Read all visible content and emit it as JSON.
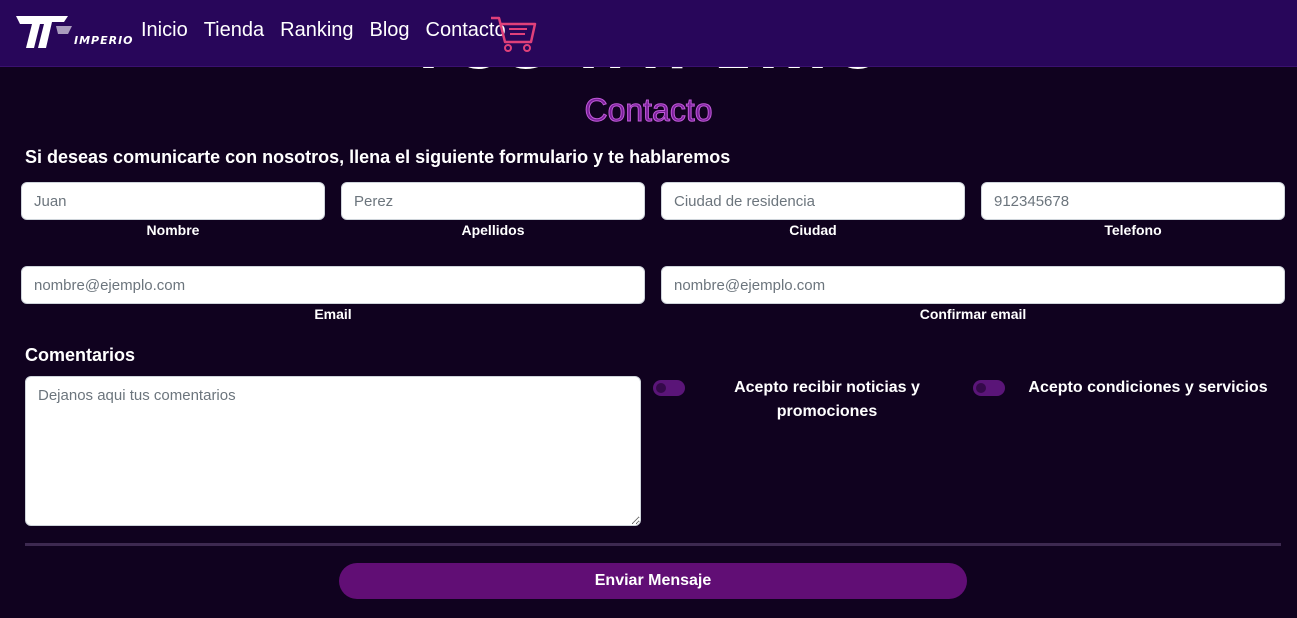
{
  "header": {
    "logo_text": "IMPERIO",
    "nav": [
      "Inicio",
      "Tienda",
      "Ranking",
      "Blog",
      "Contacto"
    ],
    "cart_icon": "shopping-cart-icon"
  },
  "hero": {
    "title": "TCG IMPERIO"
  },
  "contact": {
    "title": "Contacto",
    "intro": "Si deseas comunicarte con nosotros, llena el siguiente formulario y te hablaremos",
    "fields": {
      "nombre": {
        "placeholder": "Juan",
        "label": "Nombre"
      },
      "apellidos": {
        "placeholder": "Perez",
        "label": "Apellidos"
      },
      "ciudad": {
        "placeholder": "Ciudad de residencia",
        "label": "Ciudad"
      },
      "telefono": {
        "placeholder": "912345678",
        "label": "Telefono"
      },
      "email": {
        "placeholder": "nombre@ejemplo.com",
        "label": "Email"
      },
      "confirm_email": {
        "placeholder": "nombre@ejemplo.com",
        "label": "Confirmar email"
      }
    },
    "comments": {
      "label": "Comentarios",
      "placeholder": "Dejanos aqui tus comentarios"
    },
    "toggles": {
      "news": {
        "label": "Acepto recibir noticias y promociones"
      },
      "terms": {
        "label": "Acepto condiciones y servicios"
      }
    },
    "submit_label": "Enviar Mensaje"
  },
  "colors": {
    "background": "#10021f",
    "navbar": "#28065a",
    "accent": "#610e75",
    "cart": "#e0407a"
  }
}
